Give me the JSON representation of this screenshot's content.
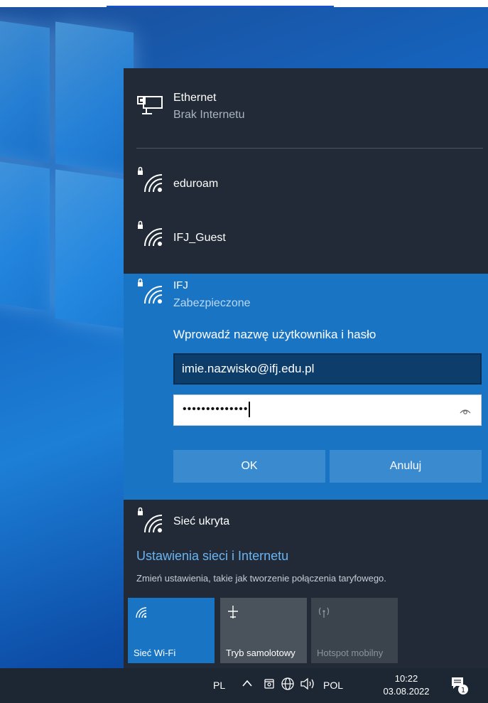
{
  "ethernet": {
    "name": "Ethernet",
    "status": "Brak Internetu",
    "icon": "ethernet-icon"
  },
  "networks": [
    {
      "name": "eduroam",
      "icon": "wifi-secured-icon"
    },
    {
      "name": "IFJ_Guest",
      "icon": "wifi-secured-icon"
    }
  ],
  "active_network": {
    "name": "IFJ",
    "status": "Zabezpieczone",
    "prompt": "Wprowadź nazwę użytkownika i hasło",
    "username_value": "imie.nazwisko@ifj.edu.pl",
    "password_mask": "••••••••••••••",
    "ok_label": "OK",
    "cancel_label": "Anuluj"
  },
  "hidden_network": {
    "name": "Sieć ukryta",
    "icon": "wifi-secured-icon"
  },
  "settings": {
    "link": "Ustawienia sieci i Internetu",
    "description": "Zmień ustawienia, takie jak tworzenie połączenia taryfowego."
  },
  "quick_actions": [
    {
      "label": "Sieć Wi-Fi",
      "icon": "wifi-icon",
      "state": "on"
    },
    {
      "label": "Tryb samolotowy",
      "icon": "airplane-icon",
      "state": "off"
    },
    {
      "label": "Hotspot mobilny",
      "icon": "hotspot-icon",
      "state": "disabled"
    }
  ],
  "taskbar": {
    "keyboard_lang": "PL",
    "input_lang": "POL",
    "time": "10:22",
    "date": "03.08.2022",
    "notification_count": "1"
  },
  "colors": {
    "flyout_bg": "#212a36",
    "accent": "#1a74c4",
    "link": "#6ab4f2"
  }
}
